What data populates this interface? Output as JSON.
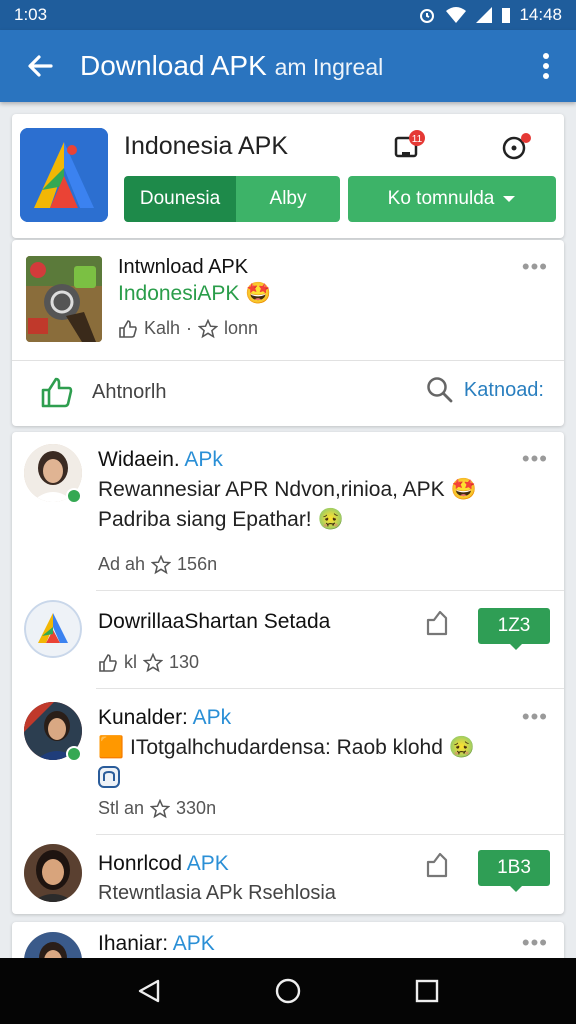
{
  "status": {
    "time": "1:03",
    "clock": "14:48"
  },
  "appbar": {
    "title": "Download APK",
    "subtitle": "am Ingreal"
  },
  "header": {
    "title": "Indonesia APK",
    "badge": "11",
    "split_left": "Dounesia",
    "split_right": "Alby",
    "dropdown_label": "Ko tomnulda"
  },
  "feature": {
    "title": "Intwnload APK",
    "subtitle": "IndonesiAPK 🤩",
    "meta_left": "Kalh",
    "meta_sep": "·",
    "meta_right": "lonn",
    "dots": "•••",
    "like_label": "Ahtnorlh",
    "search_label": "Katnoad:"
  },
  "posts": [
    {
      "name": "Widaein.",
      "tag": "APk",
      "line1": "Rewannesiar APR Ndvon,rinioa, APK 🤩",
      "line2": "Padriba siang Epathar! 🤢",
      "meta_left": "Ad ah",
      "meta_right": "156n",
      "dots": "•••"
    },
    {
      "name": "DowrillaaShartan Setada",
      "meta_left": "kl",
      "meta_right": "130",
      "count": "1Z3"
    },
    {
      "name": "Kunalder:",
      "tag": "APk",
      "line1": "🟧 ITotgalhchudardensa: Raob klohd 🤢",
      "meta_left": "Stl an",
      "meta_right": "330n",
      "dots": "•••"
    },
    {
      "name": "Honrlcod",
      "tag": "APK",
      "line1": "Rtewntlasia APk Rsehlosia",
      "count": "1B3"
    },
    {
      "name": "Ihaniar:",
      "tag": "APK",
      "dots": "•••"
    }
  ],
  "colors": {
    "statusbar": "#1f5d9c",
    "appbar": "#2a74bf",
    "green_dark": "#1e8a4a",
    "green": "#3db368",
    "accent_blue": "#2a8fd6"
  },
  "icons": [
    "back-arrow-icon",
    "more-vert-icon",
    "notification-icon",
    "settings-icon",
    "thumbs-up-icon",
    "star-icon",
    "search-icon",
    "share-icon",
    "nav-back-icon",
    "nav-home-icon",
    "nav-recents-icon"
  ]
}
